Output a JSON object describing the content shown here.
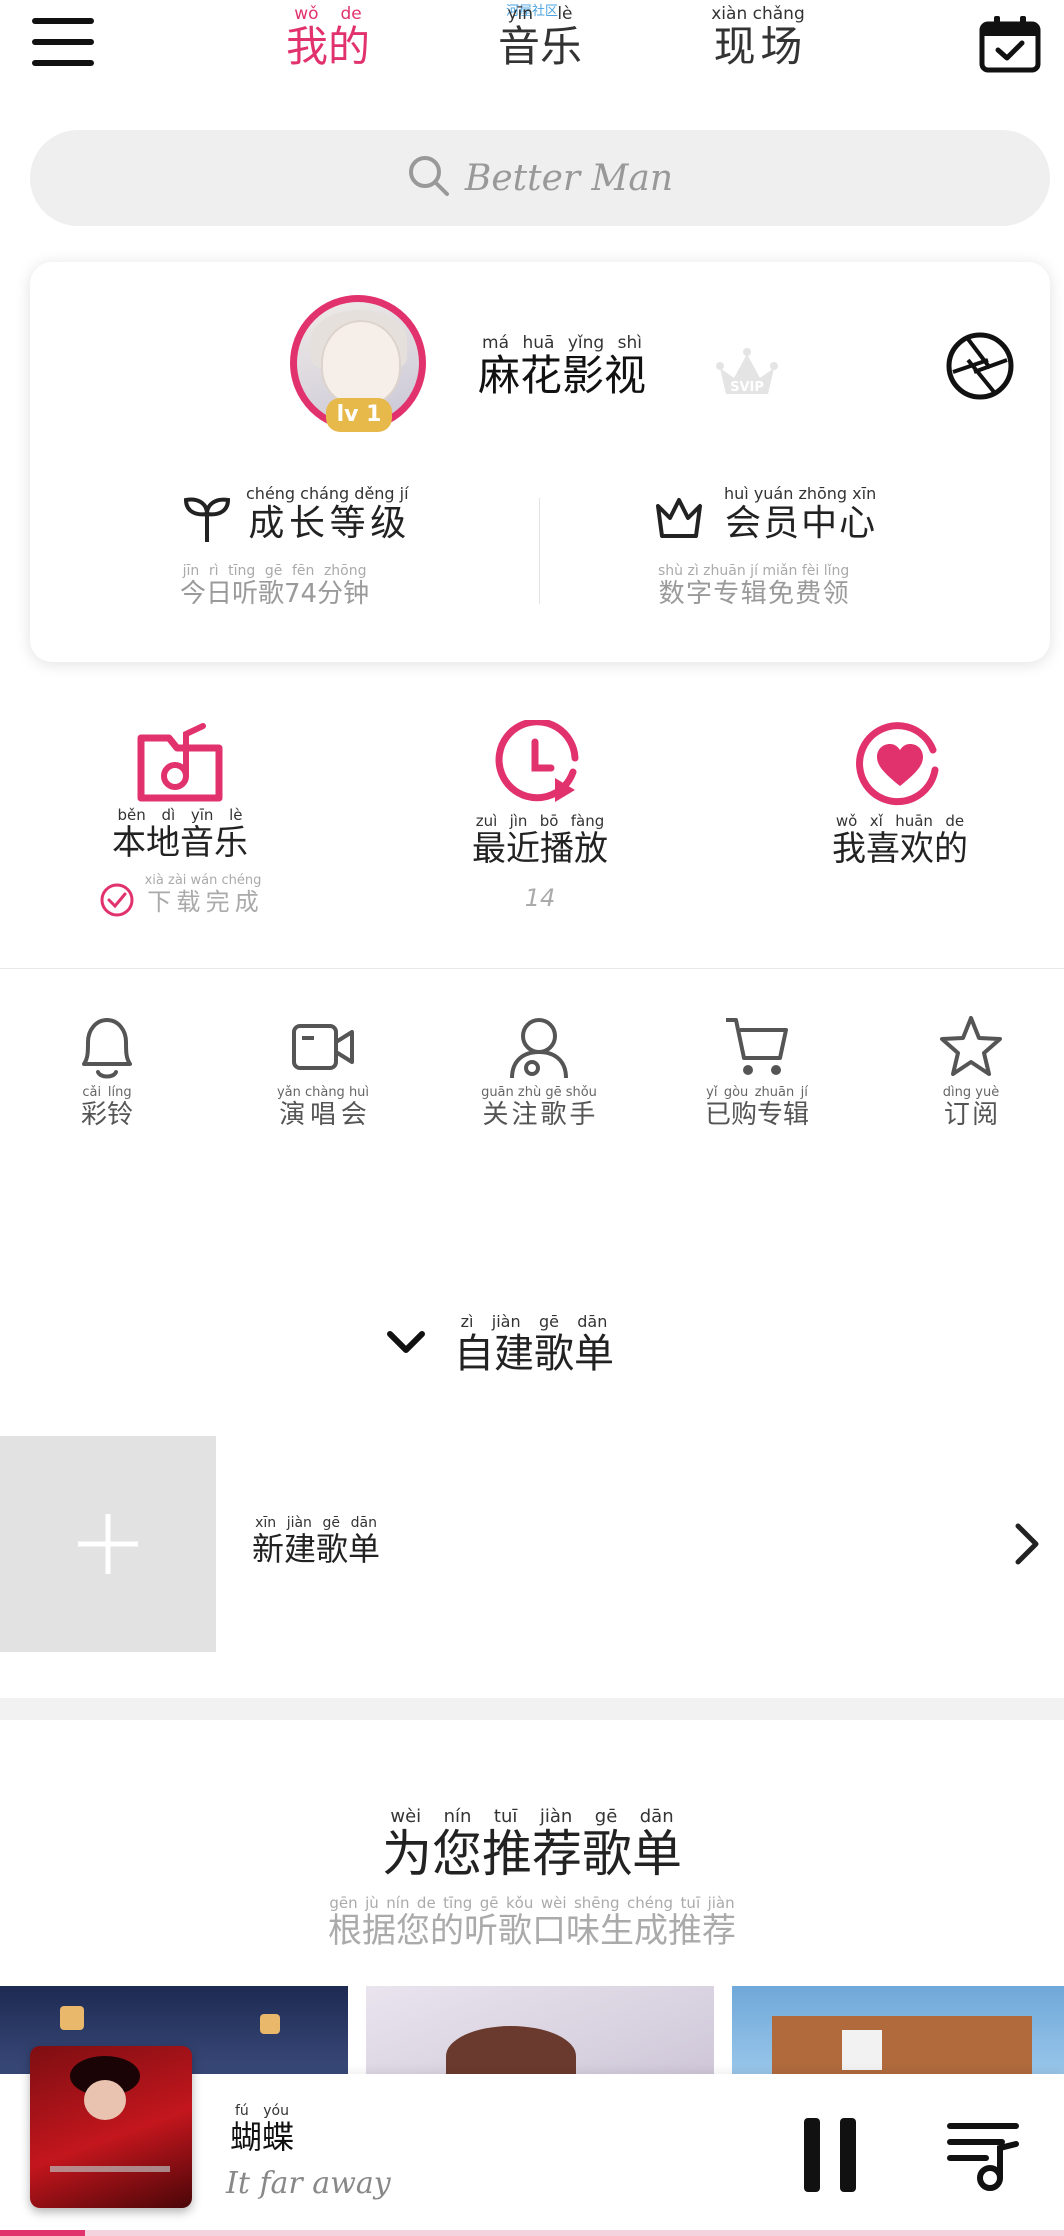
{
  "colors": {
    "accent": "#e2326d",
    "badge": "#e7b84a",
    "muted": "#9a9a9a"
  },
  "header": {
    "menu_icon": "hamburger-menu-icon",
    "tabs": [
      {
        "text": "我的",
        "pinyin": "wǒ de",
        "active": true
      },
      {
        "text": "音乐",
        "pinyin": "yīn lè",
        "active": false
      },
      {
        "text": "现场",
        "pinyin": "xiàn chǎng",
        "active": false
      }
    ],
    "tab_badge": "河屋社区",
    "calendar_icon": "calendar-check-icon"
  },
  "search": {
    "placeholder": "Better Man",
    "icon": "search-icon"
  },
  "profile": {
    "username": "麻花影视",
    "username_pinyin": "má huā yǐng shì",
    "level": "lv 1",
    "vip_badge": "SVIP",
    "settings_icon": "aperture-settings-icon",
    "growth": {
      "title": "成长等级",
      "title_pinyin": "chéng cháng děng jí",
      "sub": "今日听歌74分钟",
      "sub_pinyin": "jīn rì tīng gē fēn zhōng",
      "icon": "sprout-icon"
    },
    "member": {
      "title": "会员中心",
      "title_pinyin": "huì yuán zhōng xīn",
      "sub": "数字专辑免费领",
      "sub_pinyin": "shù zì zhuān jí miǎn fèi lǐng",
      "icon": "crown-icon"
    }
  },
  "quick": [
    {
      "label": "本地音乐",
      "pinyin": "běn dì yīn lè",
      "sub": "下载完成",
      "sub_pinyin": "xià zài wán chéng",
      "icon": "local-music-folder-icon"
    },
    {
      "label": "最近播放",
      "pinyin": "zuì jìn bō fàng",
      "sub": "14",
      "icon": "recent-play-clock-icon"
    },
    {
      "label": "我喜欢的",
      "pinyin": "wǒ xǐ huān de",
      "sub": "",
      "icon": "heart-circle-icon"
    }
  ],
  "tools": [
    {
      "label": "彩铃",
      "pinyin": "cǎi líng",
      "icon": "bell-icon"
    },
    {
      "label": "演唱会",
      "pinyin": "yǎn chàng huì",
      "icon": "video-camera-icon"
    },
    {
      "label": "关注歌手",
      "pinyin": "guān zhù gē shǒu",
      "icon": "singer-user-icon"
    },
    {
      "label": "已购专辑",
      "pinyin": "yǐ gòu zhuān jí",
      "icon": "shopping-cart-icon"
    },
    {
      "label": "订阅",
      "pinyin": "dìng yuè",
      "icon": "star-icon"
    }
  ],
  "playlists": {
    "header": "自建歌单",
    "header_pinyin": "zì jiàn gē dān",
    "new_label": "新建歌单",
    "new_pinyin": "xīn jiàn gē dān"
  },
  "recommend": {
    "title": "为您推荐歌单",
    "title_pinyin": "wèi nín tuī jiàn gē dān",
    "subtitle": "根据您的听歌口味生成推荐",
    "subtitle_pinyin": "gēn jù nín de tīng gē kǒu wèi shēng chéng tuī jiàn"
  },
  "player": {
    "title": "蝴蝶",
    "title_pinyin": "fú yóu",
    "artist": "It far away",
    "progress": 0.08,
    "pause_icon": "pause-icon",
    "queue_icon": "playlist-queue-icon"
  }
}
